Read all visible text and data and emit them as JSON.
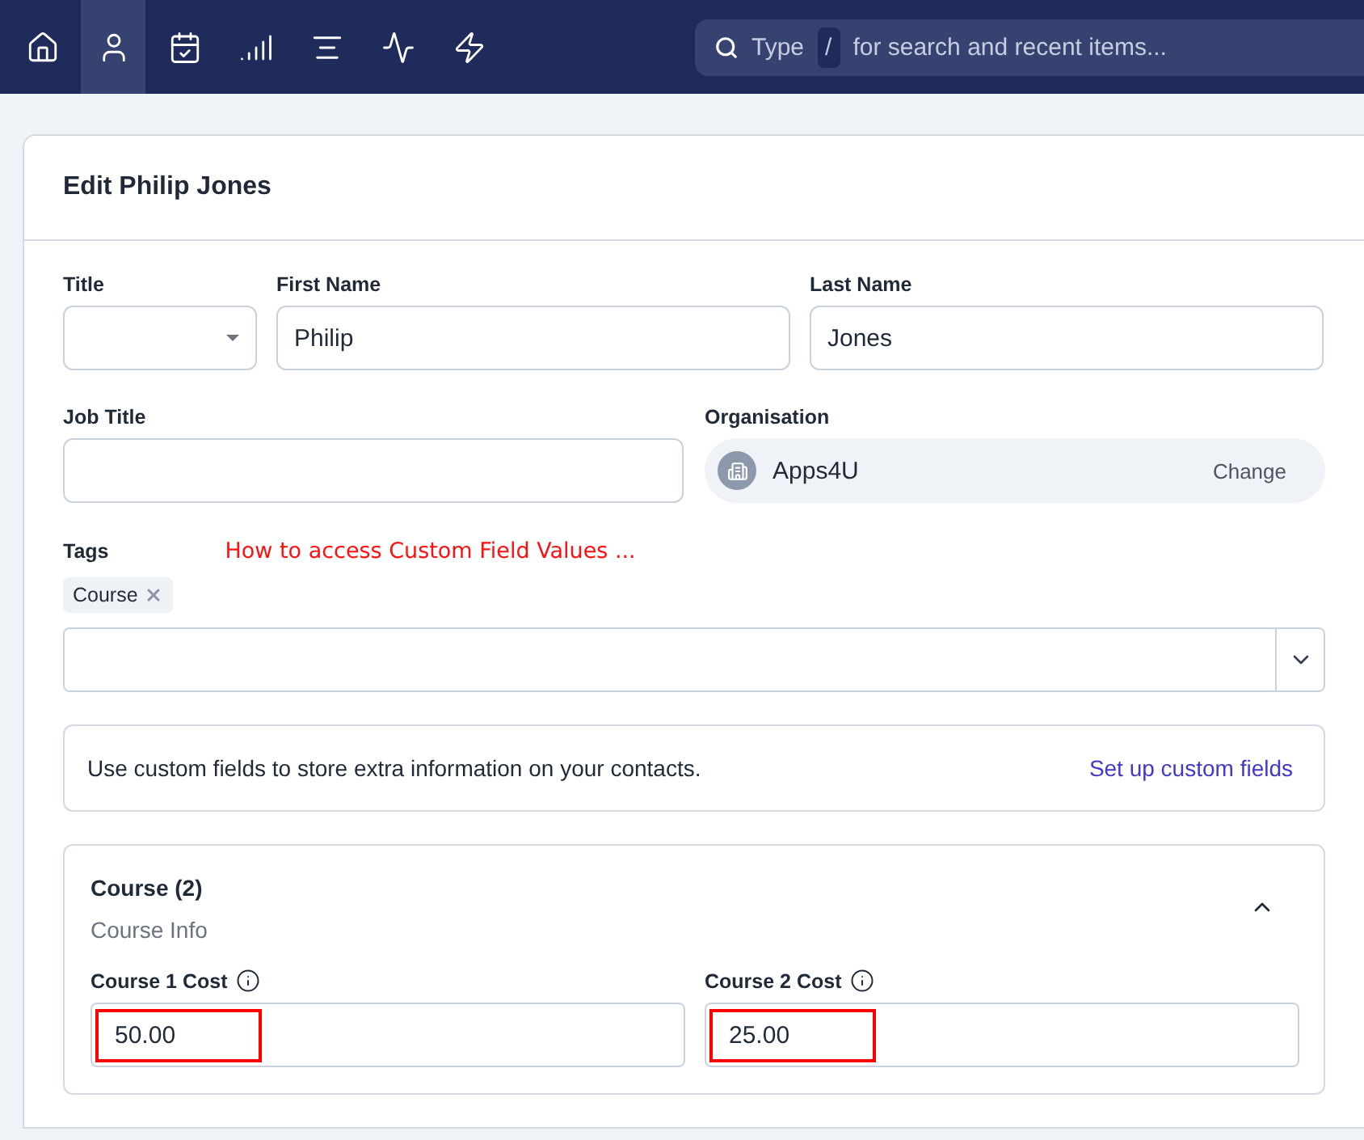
{
  "nav": {
    "items": [
      {
        "selected": false
      },
      {
        "selected": true
      },
      {
        "selected": false
      },
      {
        "selected": false
      },
      {
        "selected": false
      },
      {
        "selected": false
      },
      {
        "selected": false
      }
    ],
    "search": {
      "placeholder_before": "Type",
      "key": "/",
      "placeholder_after": "for search and recent items..."
    }
  },
  "card": {
    "title": "Edit Philip Jones",
    "row_1": [
      {
        "kind": "select",
        "label": "Title"
      },
      {
        "kind": "text",
        "label": "First Name",
        "value": "Philip"
      },
      {
        "kind": "text",
        "label": "Last Name",
        "value": "Jones"
      }
    ],
    "row_2": [
      {
        "kind": "text",
        "label": "Job Title"
      },
      {
        "kind": "org",
        "label": "Organisation",
        "value": "Apps4U",
        "action": "Change"
      }
    ],
    "tags": {
      "label": "Tags",
      "annotation": "How to access Custom Field Values ...",
      "chips": [
        "Course"
      ]
    },
    "custom_fields_notice": {
      "text": "Use custom fields to store extra information on your contacts.",
      "link": "Set up custom fields"
    },
    "custom_group": {
      "title": "Course (2)",
      "subtitle": "Course Info",
      "expanded": true,
      "fields": [
        {
          "label": "Course 1 Cost",
          "value": "50.00",
          "highlighted": true
        },
        {
          "label": "Course 2 Cost",
          "value": "25.00",
          "highlighted": true
        }
      ]
    }
  }
}
